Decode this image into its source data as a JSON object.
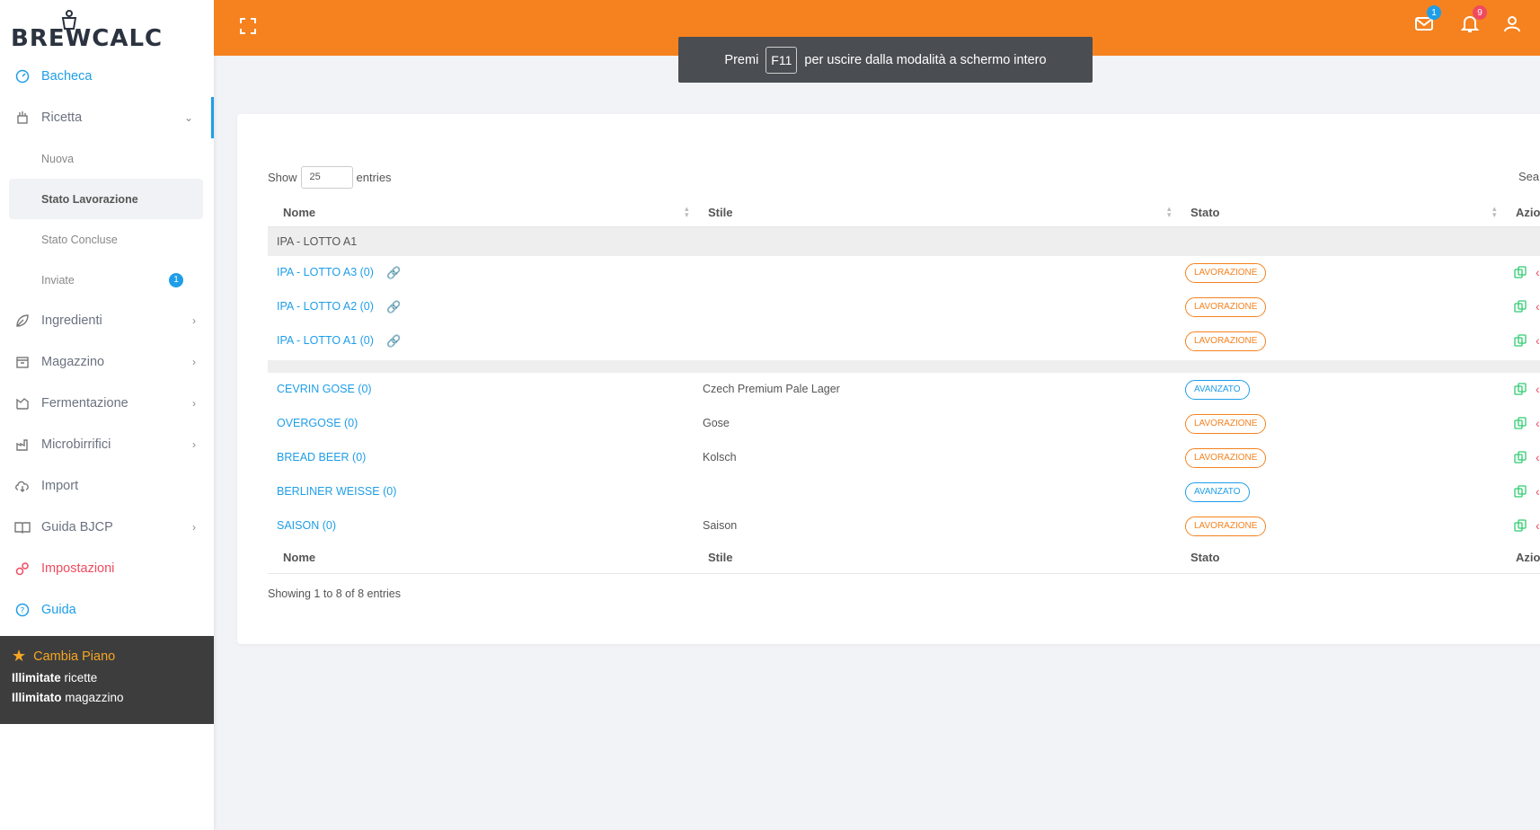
{
  "brand": {
    "name": "BREWCALC"
  },
  "sidebar": {
    "items": [
      {
        "label": "Bacheca",
        "icon": "dashboard-icon",
        "color": "#1e9ee8"
      },
      {
        "label": "Ricetta",
        "icon": "recipe-icon"
      },
      {
        "label": "Ingredienti",
        "icon": "leaf-icon"
      },
      {
        "label": "Magazzino",
        "icon": "box-icon"
      },
      {
        "label": "Fermentazione",
        "icon": "fermentation-icon"
      },
      {
        "label": "Microbirrifici",
        "icon": "factory-icon"
      },
      {
        "label": "Import",
        "icon": "cloud-download-icon"
      },
      {
        "label": "Guida BJCP",
        "icon": "book-icon"
      },
      {
        "label": "Impostazioni",
        "icon": "gears-icon",
        "color": "#ef4a5f"
      },
      {
        "label": "Guida",
        "icon": "help-icon",
        "color": "#1e9ee8"
      }
    ],
    "ricetta_sub": [
      {
        "label": "Nuova"
      },
      {
        "label": "Stato Lavorazione"
      },
      {
        "label": "Stato Concluse"
      },
      {
        "label": "Inviate",
        "badge": "1"
      }
    ],
    "plan": {
      "title": "Cambia Piano",
      "line1_bold": "Illimitate",
      "line1_rest": " ricette",
      "line2_bold": "Illimitato",
      "line2_rest": " magazzino"
    }
  },
  "topbar": {
    "accent": "#f5821f",
    "mail_badge": "1",
    "notif_badge": "9"
  },
  "fullscreen_toast": {
    "before": "Premi",
    "key": "F11",
    "after": "per uscire dalla modalità a schermo intero"
  },
  "table": {
    "show_label": "Show",
    "entries_value": "25",
    "entries_label": "entries",
    "search_label": "Sea",
    "columns": [
      "Nome",
      "Stile",
      "Stato",
      "Azio"
    ],
    "group1": "IPA - LOTTO A1",
    "group1_rows": [
      {
        "name": "IPA - LOTTO A3 (0)",
        "style": "",
        "status": "LAVORAZIONE"
      },
      {
        "name": "IPA - LOTTO A2 (0)",
        "style": "",
        "status": "LAVORAZIONE"
      },
      {
        "name": "IPA - LOTTO A1 (0)",
        "style": "",
        "status": "LAVORAZIONE"
      }
    ],
    "group2_rows": [
      {
        "name": "CEVRIN GOSE (0)",
        "style": "Czech Premium Pale Lager",
        "status": "AVANZATO"
      },
      {
        "name": "OVERGOSE (0)",
        "style": "Gose",
        "status": "LAVORAZIONE"
      },
      {
        "name": "BREAD BEER (0)",
        "style": "Kolsch",
        "status": "LAVORAZIONE"
      },
      {
        "name": "BERLINER WEISSE (0)",
        "style": "",
        "status": "AVANZATO"
      },
      {
        "name": "SAISON (0)",
        "style": "Saison",
        "status": "LAVORAZIONE"
      }
    ],
    "info": "Showing 1 to 8 of 8 entries"
  }
}
